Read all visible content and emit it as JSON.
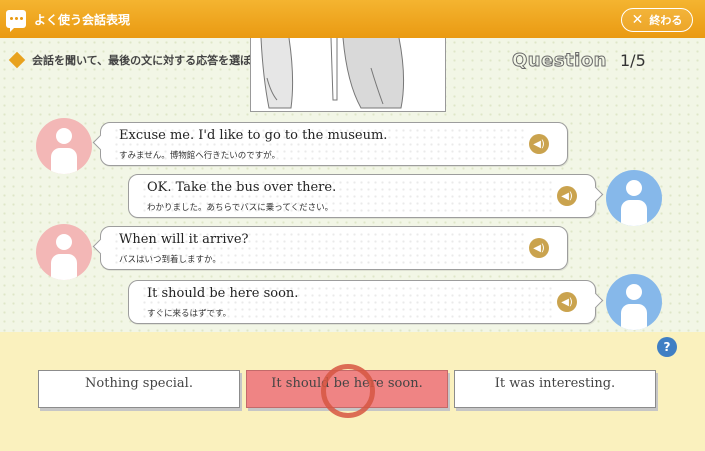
{
  "header": {
    "title": "よく使う会話表現",
    "close_label": "終わる"
  },
  "instruction": "会話を聞いて、最後の文に対する応答を選ぼう！",
  "question": {
    "label": "Question",
    "number": "1/5"
  },
  "dialogue": [
    {
      "speaker": "left",
      "english": "Excuse me.  I'd like to go to the museum.",
      "japanese": "すみません。博物館へ行きたいのですが。"
    },
    {
      "speaker": "right",
      "english": "OK.  Take the bus over there.",
      "japanese": "わかりました。あちらでバスに乗ってください。"
    },
    {
      "speaker": "left",
      "english": "When will it arrive?",
      "japanese": "バスはいつ到着しますか。"
    },
    {
      "speaker": "right",
      "english": "It should be here soon.",
      "japanese": "すぐに来るはずです。"
    }
  ],
  "choices": [
    {
      "label": "Nothing special."
    },
    {
      "label": "It should be here soon."
    },
    {
      "label": "It was interesting."
    }
  ],
  "help_label": "?",
  "colors": {
    "header": "#ea9a12",
    "dialog_bg": "#f2f6e6",
    "answer_bg": "#faf1be",
    "selected_choice": "#ef8484",
    "speaker_icon": "#caa34e",
    "avatar_left": "#f3b7b6",
    "avatar_right": "#86b8ea",
    "help_icon": "#3f7fc4"
  },
  "icons": {
    "app": "speech-bubble-icon",
    "close": "close-icon",
    "speaker": "speaker-icon",
    "help": "help-icon",
    "instruction": "diamond-bullet-icon"
  }
}
